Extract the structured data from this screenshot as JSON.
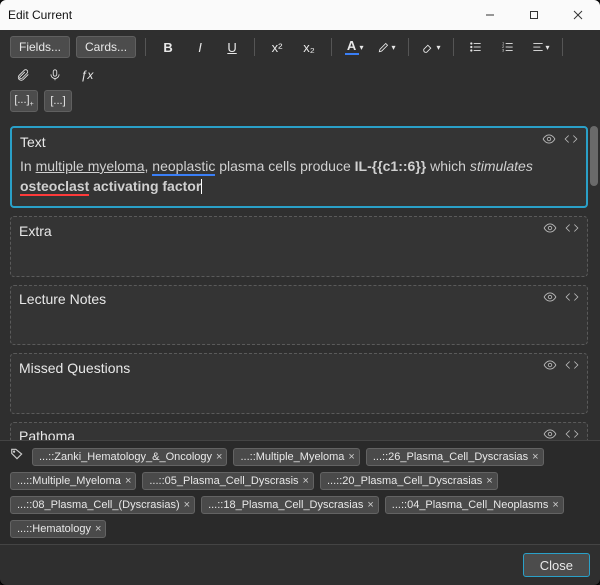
{
  "window": {
    "title": "Edit Current"
  },
  "toolbar": {
    "fields_btn": "Fields...",
    "cards_btn": "Cards...",
    "bold": "B",
    "italic": "I",
    "underline": "U",
    "sup": "x²",
    "sub": "x₂"
  },
  "fields": [
    {
      "label": "Text",
      "active": true,
      "content_html": "In <span class='u'>multiple myeloma</span>, <span class='sp-blue'>neoplastic</span> plasma cells produce <span class='b'>IL-{{c1::6}}</span> which <span class='i'>stimulates</span> <span class='b'><span class='sp-red'>osteoclast</span> activating factor</span><span class='caret'></span>"
    },
    {
      "label": "Extra",
      "active": false,
      "content_html": "&nbsp;"
    },
    {
      "label": "Lecture Notes",
      "active": false,
      "content_html": "&nbsp;"
    },
    {
      "label": "Missed Questions",
      "active": false,
      "content_html": "&nbsp;"
    },
    {
      "label": "Pathoma",
      "active": false,
      "content_html": ""
    }
  ],
  "tags": [
    "...::Zanki_Hematology_&_Oncology",
    "...::Multiple_Myeloma",
    "...::26_Plasma_Cell_Dyscrasias",
    "...::Multiple_Myeloma",
    "...::05_Plasma_Cell_Dyscrasis",
    "...::20_Plasma_Cell_Dyscrasias",
    "...::08_Plasma_Cell_(Dyscrasias)",
    "...::18_Plasma_Cell_Dyscrasias",
    "...::04_Plasma_Cell_Neoplasms",
    "...::Hematology"
  ],
  "footer": {
    "close": "Close"
  }
}
